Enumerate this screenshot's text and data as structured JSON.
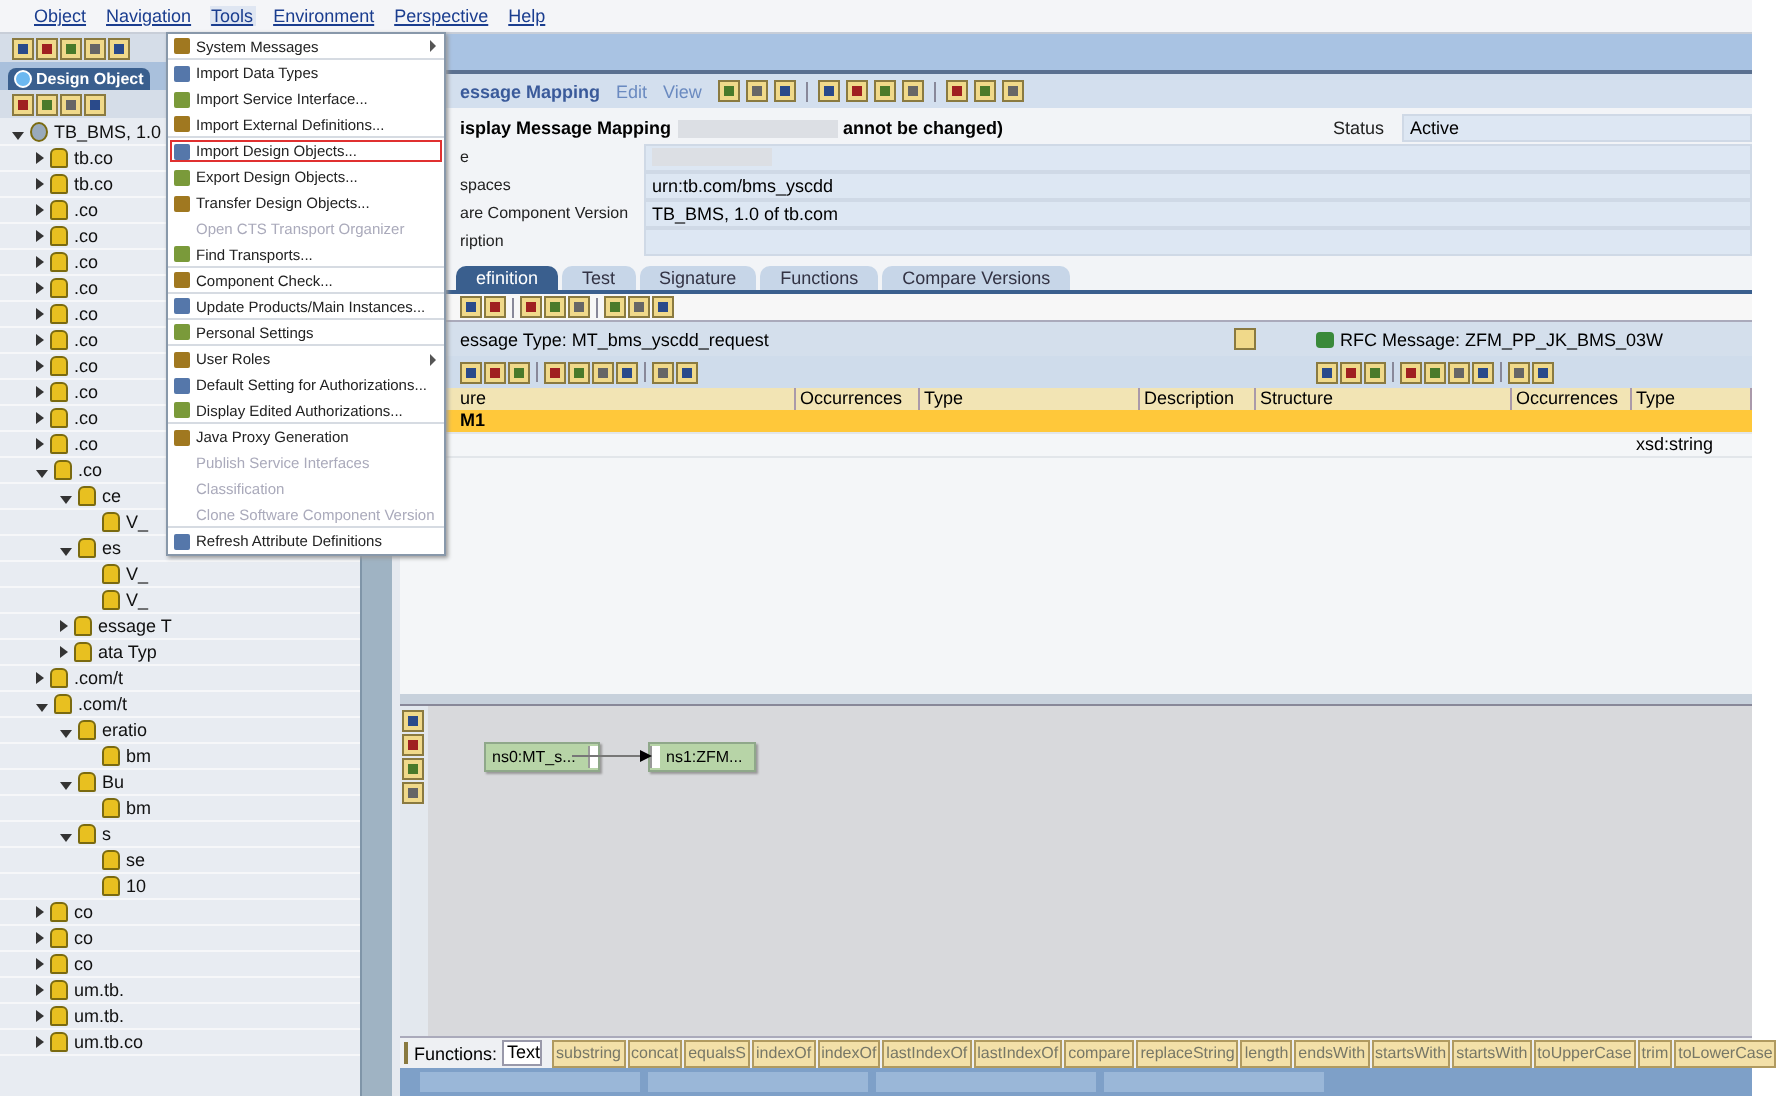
{
  "menu_bar": [
    {
      "label": "Object",
      "selected": false
    },
    {
      "label": "Navigation",
      "selected": false
    },
    {
      "label": "Tools",
      "selected": true
    },
    {
      "label": "Environment",
      "selected": false
    },
    {
      "label": "Perspective",
      "selected": false
    },
    {
      "label": "Help",
      "selected": false
    }
  ],
  "tools_menu": [
    {
      "label": "System Messages",
      "kind": "submenu",
      "disabled": false,
      "highlighted": false
    },
    {
      "label": "Import Data Types",
      "kind": "item",
      "disabled": false,
      "highlighted": false
    },
    {
      "label": "Import Service Interface...",
      "kind": "item",
      "disabled": false,
      "highlighted": false
    },
    {
      "label": "Import External Definitions...",
      "kind": "item",
      "disabled": false,
      "highlighted": false
    },
    {
      "label": "Import Design Objects...",
      "kind": "item",
      "disabled": false,
      "highlighted": true
    },
    {
      "label": "Export Design Objects...",
      "kind": "item",
      "disabled": false,
      "highlighted": false
    },
    {
      "label": "Transfer Design Objects...",
      "kind": "item",
      "disabled": false,
      "highlighted": false
    },
    {
      "label": "Open CTS Transport Organizer",
      "kind": "item",
      "disabled": true,
      "highlighted": false
    },
    {
      "label": "Find Transports...",
      "kind": "item",
      "disabled": false,
      "highlighted": false
    },
    {
      "label": "Component Check...",
      "kind": "item",
      "disabled": false,
      "highlighted": false
    },
    {
      "label": "Update Products/Main Instances...",
      "kind": "item",
      "disabled": false,
      "highlighted": false
    },
    {
      "label": "Personal Settings",
      "kind": "item",
      "disabled": false,
      "highlighted": false
    },
    {
      "label": "User Roles",
      "kind": "submenu",
      "disabled": false,
      "highlighted": false
    },
    {
      "label": "Default Setting for Authorizations...",
      "kind": "item",
      "disabled": false,
      "highlighted": false
    },
    {
      "label": "Display Edited Authorizations...",
      "kind": "item",
      "disabled": false,
      "highlighted": false
    },
    {
      "label": "Java Proxy Generation",
      "kind": "item",
      "disabled": false,
      "highlighted": false
    },
    {
      "label": "Publish Service Interfaces",
      "kind": "item",
      "disabled": true,
      "highlighted": false
    },
    {
      "label": "Classification",
      "kind": "item",
      "disabled": true,
      "highlighted": false
    },
    {
      "label": "Clone Software Component Version",
      "kind": "item",
      "disabled": true,
      "highlighted": false
    },
    {
      "label": "Refresh Attribute Definitions",
      "kind": "item",
      "disabled": false,
      "highlighted": false
    }
  ],
  "navigator": {
    "tab": "Design Object",
    "tree": [
      {
        "label": "TB_BMS, 1.0",
        "expanded": true,
        "children": [
          {
            "label": "tb.co",
            "expanded": false
          },
          {
            "label": "tb.co",
            "expanded": false
          },
          {
            "label": ".co",
            "expanded": false
          },
          {
            "label": ".co",
            "expanded": false
          },
          {
            "label": ".co",
            "expanded": false
          },
          {
            "label": ".co",
            "expanded": false
          },
          {
            "label": ".co",
            "expanded": false
          },
          {
            "label": ".co",
            "expanded": false
          },
          {
            "label": ".co",
            "expanded": false
          },
          {
            "label": ".co",
            "expanded": false
          },
          {
            "label": ".co",
            "expanded": false
          },
          {
            "label": ".co",
            "expanded": false
          },
          {
            "label": ".co",
            "expanded": true,
            "children": [
              {
                "label": "ce",
                "expanded": true,
                "children": [
                  {
                    "label": "V_"
                  }
                ]
              },
              {
                "label": "es",
                "expanded": true,
                "children": [
                  {
                    "label": "V_"
                  },
                  {
                    "label": "V_"
                  }
                ]
              },
              {
                "label": "essage T",
                "expanded": false
              },
              {
                "label": "ata Typ",
                "expanded": false
              }
            ]
          },
          {
            "label": ".com/t",
            "expanded": false
          },
          {
            "label": ".com/t",
            "expanded": true,
            "children": [
              {
                "label": "eratio",
                "expanded": true,
                "children": [
                  {
                    "label": "bm"
                  }
                ]
              },
              {
                "label": "Bu",
                "expanded": true,
                "children": [
                  {
                    "label": "bm"
                  }
                ]
              },
              {
                "label": "s",
                "expanded": true,
                "children": [
                  {
                    "label": "se"
                  },
                  {
                    "label": "10"
                  }
                ]
              }
            ]
          },
          {
            "label": "co",
            "expanded": false
          },
          {
            "label": "co",
            "expanded": false
          },
          {
            "label": "co",
            "expanded": false
          },
          {
            "label": "um.tb.",
            "expanded": false
          },
          {
            "label": "um.tb.",
            "expanded": false
          },
          {
            "label": "um.tb.co",
            "expanded": false
          }
        ]
      }
    ]
  },
  "editor": {
    "menu": [
      "essage Mapping",
      "Edit",
      "View"
    ],
    "title": "isplay Message Mapping",
    "title_end": "annot be changed)",
    "status": {
      "label": "Status",
      "value": "Active"
    },
    "fields": [
      {
        "label": "e"
      },
      {
        "label": "spaces",
        "value": "urn:tb.com/bms_yscdd"
      },
      {
        "label": "are Component Version",
        "value": "TB_BMS, 1.0 of tb.com"
      },
      {
        "label": "ription"
      }
    ],
    "tabs": [
      {
        "label": "efinition",
        "selected": true
      },
      {
        "label": "Test",
        "selected": false
      },
      {
        "label": "Signature",
        "selected": false
      },
      {
        "label": "Functions",
        "selected": false
      },
      {
        "label": "Compare Versions",
        "selected": false
      }
    ],
    "source": {
      "title": "essage Type: MT_bms_yscdd_request",
      "columns": [
        "ure",
        "Occurrences",
        "Type",
        "Description"
      ],
      "rows": [
        {
          "cells": [
            "M1",
            "",
            "",
            ""
          ],
          "selected": true
        },
        {
          "cells": [
            "",
            "",
            "",
            ""
          ],
          "selected": false
        }
      ]
    },
    "target": {
      "title": "RFC Message: ZFM_PP_JK_BMS_03W",
      "columns": [
        "Structure",
        "Occurrences",
        "Type"
      ],
      "rows": [
        {
          "cells": [
            "",
            "",
            ""
          ],
          "selected": true
        },
        {
          "cells": [
            "",
            "",
            "xsd:string"
          ],
          "selected": false
        }
      ]
    },
    "nodes": [
      {
        "label": "ns0:MT_s..."
      },
      {
        "label": "ns1:ZFM..."
      }
    ],
    "functions": {
      "label": "Functions:",
      "category": "Text",
      "buttons": [
        "substring",
        "concat",
        "equalsS",
        "indexOf",
        "indexOf",
        "lastIndexOf",
        "lastIndexOf",
        "compare",
        "replaceString",
        "length",
        "endsWith",
        "startsWith",
        "startsWith",
        "toUpperCase",
        "trim",
        "toLowerCase"
      ]
    }
  }
}
